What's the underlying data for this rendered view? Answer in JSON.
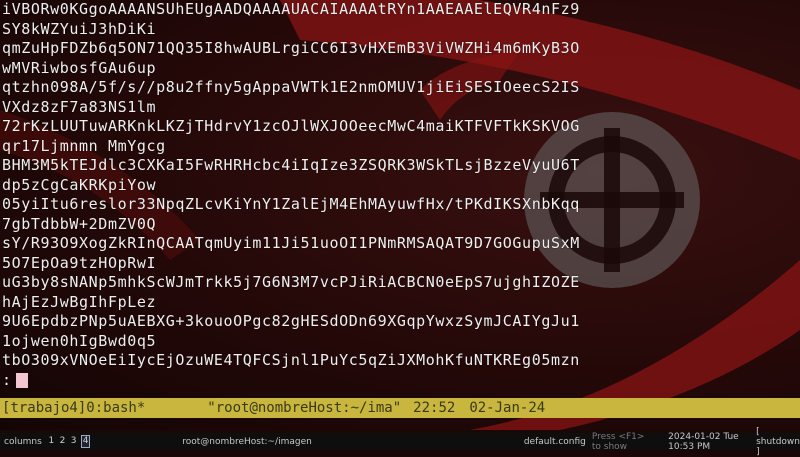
{
  "terminal": {
    "lines": [
      "iVBORw0KGgoAAAANSUhEUgAADQAAAAUACAIAAAAtRYn1AAEAAElEQVR4nFz9",
      "SY8kWZYuiJ3hDiKi",
      "qmZuHpFDZb6q5ON71QQ35I8hwAUBLrgiCC6I3vHXEmB3ViVWZHi4m6mKyB3O",
      "wMVRiwbosfGAu6up",
      "qtzhn098A/5f/s//p8u2ffny5gAppaVWTk1E2nmOMUV1jiEiSESIOeecS2IS",
      "VXdz8zF7a83NS1lm",
      "72rKzLUUTuwARKnkLKZjTHdrvY1zcOJlWXJOOeecMwC4maiKTFVFTkKSKVOG",
      "qr17Ljmnmn MmYgcg",
      "BHM3M5kTEJdlc3CXKaI5FwRHRHcbc4iIqIze3ZSQRK3WSkTLsjBzzeVyuU6T",
      "dp5zCgCaKRKpiYow",
      "05yiItu6reslor33NpqZLcvKiYnY1ZalEjM4EhMAyuwfHx/tPKdIKSXnbKqq",
      "7gbTdbbW+2DmZV0Q",
      "sY/R93O9XogZkRInQCAATqmUyim11Ji51uoOI1PNmRMSAQAT9D7GOGupuSxM",
      "5O7EpOa9tzHOpRwI",
      "uG3by8sNANp5mhkScWJmTrkk5j7G6N3M7vcPJiRiACBCN0eEpS7ujghIZOZE",
      "hAjEzJwBgIhFpLez",
      "9U6EpdbzPNp5uAEBXG+3kouoOPgc82gHESdODn69XGqpYwxzSymJCAIYgJu1",
      "1ojwen0hIgBwd0q5",
      "tbO309xVNOeEiIycEjOzuWE4TQFCSjnl1PuYc5qZiJXMohKfuNTKREg05mzn"
    ],
    "prompt": ":"
  },
  "tmux": {
    "left": "[trabajo4]0:bash*",
    "title": "\"root@nombreHost:~/ima\"",
    "time": "22:52",
    "date": "02-Jan-24"
  },
  "panel": {
    "columns_label": "columns",
    "workspaces": [
      "1",
      "2",
      "3",
      "4"
    ],
    "active_workspace": "4",
    "task": "root@nombreHost:~/imagen",
    "config": "default.config",
    "shortcut_hint": "Press <F1> to show",
    "clock": "2024-01-02 Tue 10:53 PM",
    "shutdown": "[ shutdown ]"
  },
  "colors": {
    "tmux_bar": "#c8b63e",
    "cursor": "#f4c6d2",
    "wallpaper_red": "#8a1414"
  }
}
